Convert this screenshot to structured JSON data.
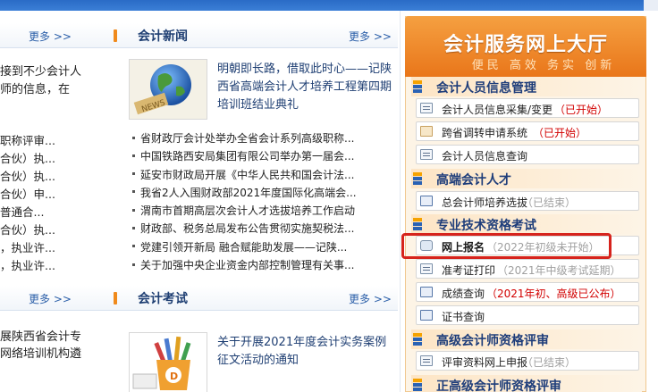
{
  "left": {
    "more_label": "更多 >>",
    "news": {
      "title": "会计新闻",
      "more_label": "更多 >>",
      "feature_text": "明朝即长路，借取此时心——记陕西省高端会计人才培养工程第四期培训班结业典礼",
      "thumb_caption": "NEWS",
      "items": [
        "省财政厅会计处举办全省会计系列高级职称...",
        "中国铁路西安局集团有限公司举办第一届会...",
        "延安市财政局开展《中华人民共和国会计法...",
        "我省2人入围财政部2021年度国际化高端会...",
        "渭南市首期高层次会计人才选拔培养工作启动",
        "财政部、税务总局发布公告贯彻实施契税法...",
        "党建引领开新局 融合赋能助发展——记陕...",
        "关于加强中央企业资金内部控制管理有关事..."
      ]
    },
    "col1_fragments_top": [
      "接到不少会计人",
      "师的信息，在"
    ],
    "col1_fragments_list": [
      "职称评审...",
      "合伙）执...",
      "合伙）执...",
      "合伙）申...",
      "普通合...",
      "合伙）执...",
      "，执业许...",
      "，执业许..."
    ],
    "exam": {
      "more_label_left": "更多 >>",
      "title": "会计考试",
      "more_label": "更多 >>",
      "feature_text": "关于开展2021年度会计实务案例征文活动的通知"
    },
    "col1_fragments_bottom": [
      "展陕西省会计专",
      "网络培训机构遴"
    ]
  },
  "panel": {
    "title": "会计服务网上大厅",
    "subtitle": "便民 高效 务实 创新",
    "groups": [
      {
        "title": "会计人员信息管理",
        "items": [
          {
            "label": "会计人员信息采集/变更",
            "status": "（已开始）",
            "status_color": "#d20000"
          },
          {
            "label": "跨省调转申请系统",
            "status": "（已开始）",
            "status_color": "#d20000"
          },
          {
            "label": "会计人员信息查询",
            "status": "",
            "status_color": ""
          }
        ]
      },
      {
        "title": "高端会计人才",
        "items": [
          {
            "label": "总会计师培养选拔",
            "status": "（已结束）",
            "status_color": "#a0a0a0"
          }
        ]
      },
      {
        "title": "专业技术资格考试",
        "items": [
          {
            "label": "网上报名",
            "status": "（2022年初级未开始）",
            "status_color": "#a0a0a0"
          },
          {
            "label": "准考证打印",
            "status": "（2021年中级考试延期）",
            "status_color": "#a0a0a0"
          },
          {
            "label": "成绩查询",
            "status": "（2021年初、高级已公布）",
            "status_color": "#d20000"
          },
          {
            "label": "证书查询",
            "status": "",
            "status_color": ""
          }
        ]
      },
      {
        "title": "高级会计师资格评审",
        "items": [
          {
            "label": "评审资料网上申报",
            "status": "（已结束）",
            "status_color": "#a0a0a0"
          }
        ]
      },
      {
        "title": "正高级会计师资格评审",
        "items": []
      }
    ]
  },
  "colors": {
    "accent_orange": "#e9761a",
    "title_blue": "#1e3d7a",
    "status_red": "#d20000",
    "highlight_red": "#d6231c"
  }
}
